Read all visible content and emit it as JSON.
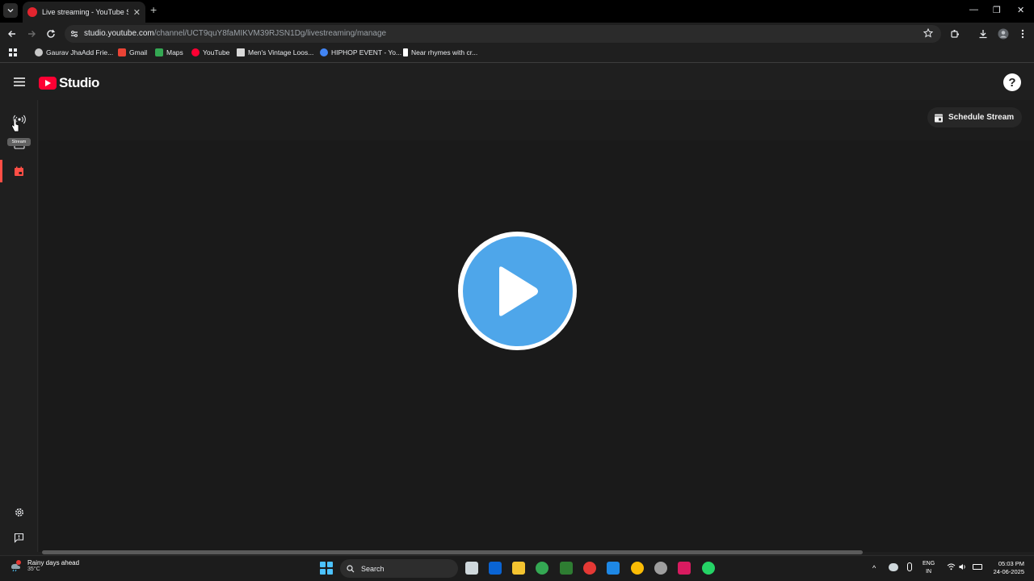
{
  "browser": {
    "tab_title": "Live streaming - YouTube Studio",
    "url_host": "studio.youtube.com",
    "url_path": "/channel/UCT9quY8faMIKVM39RJSN1Dg/livestreaming/manage",
    "bookmarks": [
      {
        "label": "Gaurav JhaAdd Frie...",
        "color": "#c7c7c7"
      },
      {
        "label": "Gmail",
        "color": "#ea4335"
      },
      {
        "label": "Maps",
        "color": "#34a853"
      },
      {
        "label": "YouTube",
        "color": "#ff0033"
      },
      {
        "label": "Men's Vintage Loos...",
        "color": "#d9d9d9"
      },
      {
        "label": "HIPHOP EVENT - Yo...",
        "color": "#4285f4"
      },
      {
        "label": "Near rhymes with cr...",
        "color": "#ffffff"
      }
    ]
  },
  "studio": {
    "logo_text": "Studio",
    "help_label": "?",
    "tooltip": "Stream",
    "schedule_label": "Schedule Stream"
  },
  "taskbar": {
    "weather_title": "Rainy days ahead",
    "weather_temp": "35°C",
    "search_label": "Search",
    "lang_line1": "ENG",
    "lang_line2": "IN",
    "time": "05:03 PM",
    "date": "24-06-2025"
  }
}
